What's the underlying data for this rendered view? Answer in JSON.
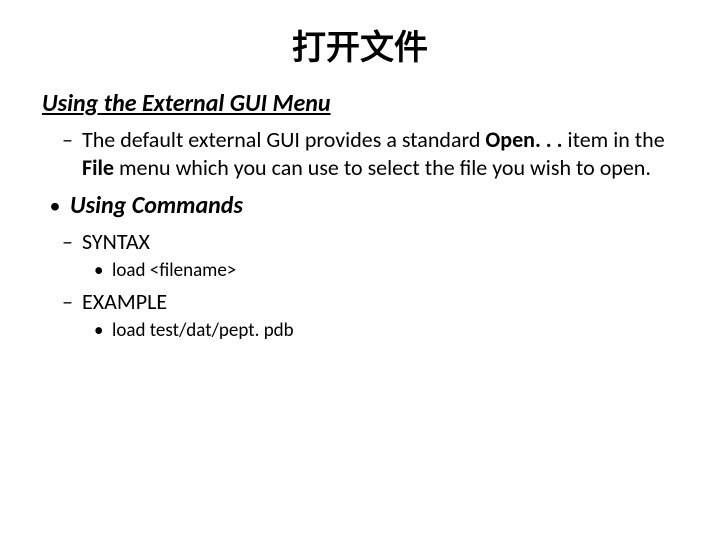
{
  "title": "打开文件",
  "heading1": "Using the External GUI Menu",
  "desc_pre": "The default external GUI provides a standard ",
  "desc_open": "Open. . . ",
  "desc_mid": "item in the ",
  "desc_file": "File",
  "desc_post": " menu which you can use to select the file you wish to open.",
  "heading2": "Using Commands",
  "syntax_label": "SYNTAX",
  "syntax_cmd": "load <filename>",
  "example_label": "EXAMPLE",
  "example_cmd": "load test/dat/pept. pdb"
}
